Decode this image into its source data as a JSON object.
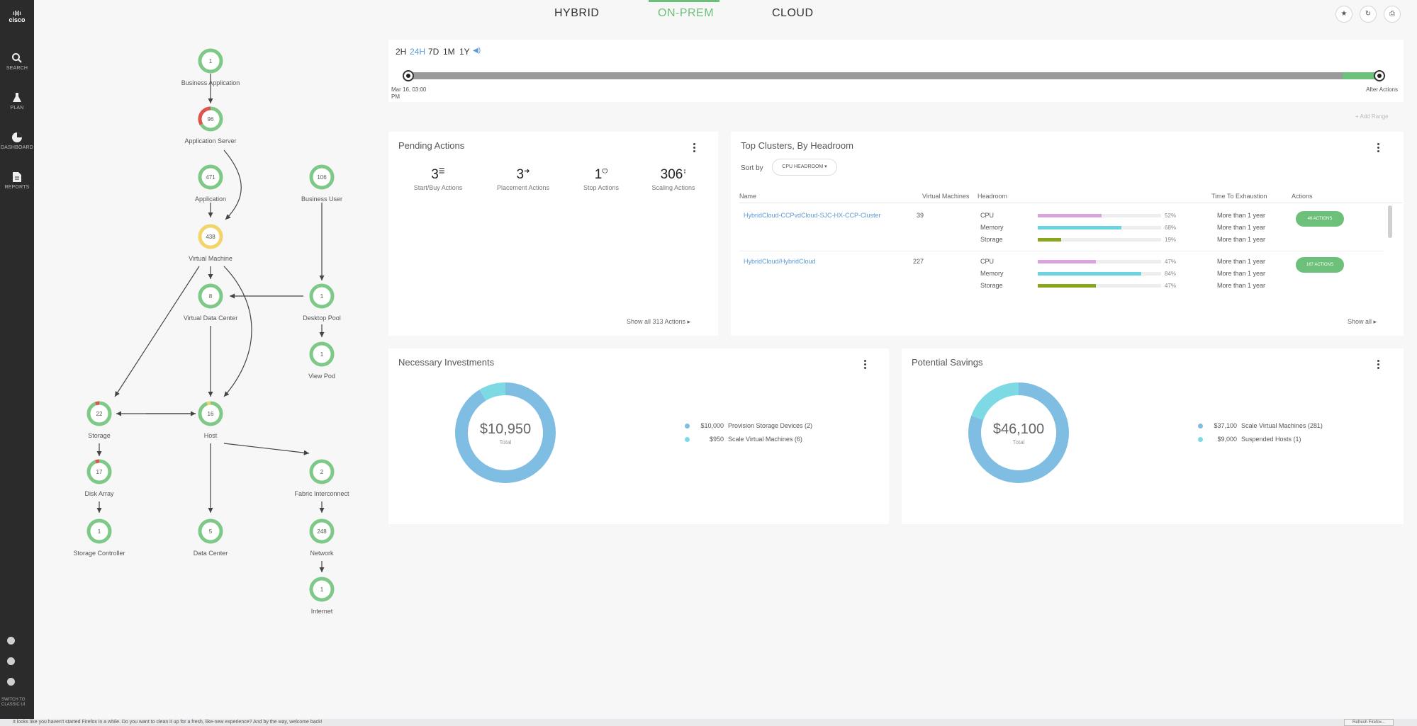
{
  "brand": {
    "logo_text": "cisco"
  },
  "sidebar": {
    "items": [
      {
        "label": "SEARCH",
        "icon": "search-icon"
      },
      {
        "label": "PLAN",
        "icon": "flask-icon"
      },
      {
        "label": "DASHBOARD",
        "icon": "dashboard-icon"
      },
      {
        "label": "REPORTS",
        "icon": "report-icon"
      }
    ],
    "footer": "SWITCH TO CLASSIC UI"
  },
  "tabs": [
    {
      "label": "HYBRID",
      "active": false
    },
    {
      "label": "ON-PREM",
      "active": true
    },
    {
      "label": "CLOUD",
      "active": false
    }
  ],
  "colors": {
    "accent_green": "#6cc07a",
    "link_blue": "#5b9bd5",
    "donut_blue": "#7fbde3",
    "donut_cyan": "#7dd9e3",
    "cpu_pink": "#d9a3e0",
    "mem_cyan": "#6cd3e0",
    "storage_olive": "#8aa61e"
  },
  "topology": {
    "nodes": [
      {
        "id": "business-application",
        "count": "1",
        "label": "Business Application"
      },
      {
        "id": "application-server",
        "count": "96",
        "label": "Application Server"
      },
      {
        "id": "application",
        "count": "471",
        "label": "Application"
      },
      {
        "id": "business-user",
        "count": "106",
        "label": "Business User"
      },
      {
        "id": "virtual-machine",
        "count": "438",
        "label": "Virtual Machine"
      },
      {
        "id": "virtual-data-center",
        "count": "8",
        "label": "Virtual Data Center"
      },
      {
        "id": "desktop-pool",
        "count": "1",
        "label": "Desktop Pool"
      },
      {
        "id": "view-pod",
        "count": "1",
        "label": "View Pod"
      },
      {
        "id": "storage",
        "count": "22",
        "label": "Storage"
      },
      {
        "id": "host",
        "count": "16",
        "label": "Host"
      },
      {
        "id": "disk-array",
        "count": "17",
        "label": "Disk Array"
      },
      {
        "id": "fabric-interconnect",
        "count": "2",
        "label": "Fabric Interconnect"
      },
      {
        "id": "storage-controller",
        "count": "1",
        "label": "Storage Controller"
      },
      {
        "id": "data-center",
        "count": "5",
        "label": "Data Center"
      },
      {
        "id": "network",
        "count": "248",
        "label": "Network"
      },
      {
        "id": "internet",
        "count": "1",
        "label": "Internet"
      }
    ]
  },
  "timeline": {
    "options": [
      "2H",
      "24H",
      "7D",
      "1M",
      "1Y"
    ],
    "selected": "24H",
    "start_label": "Mar 16, 03:00 PM",
    "end_label": "After Actions",
    "add_range": "+ Add Range"
  },
  "pending_actions": {
    "title": "Pending Actions",
    "items": [
      {
        "count": "3",
        "label": "Start/Buy Actions",
        "icon": "list-icon"
      },
      {
        "count": "3",
        "label": "Placement Actions",
        "icon": "arrow-right-icon"
      },
      {
        "count": "1",
        "label": "Stop Actions",
        "icon": "power-icon"
      },
      {
        "count": "306",
        "label": "Scaling Actions",
        "icon": "resize-icon"
      }
    ],
    "show_all": "Show all 313 Actions ▸"
  },
  "top_clusters": {
    "title": "Top Clusters, By Headroom",
    "sort_label": "Sort by",
    "sort_value": "CPU HEADROOM ▾",
    "columns": [
      "Name",
      "Virtual Machines",
      "Headroom",
      "Time To Exhaustion",
      "Actions"
    ],
    "rows": [
      {
        "name": "HybridCloud-CCPvdCloud-SJC-HX-CCP-Cluster",
        "vms": "39",
        "resources": [
          {
            "label": "CPU",
            "pct_text": "52%",
            "pct": 52,
            "tte": "More than 1 year"
          },
          {
            "label": "Memory",
            "pct_text": "68%",
            "pct": 68,
            "tte": "More than 1 year"
          },
          {
            "label": "Storage",
            "pct_text": "19%",
            "pct": 19,
            "tte": "More than 1 year"
          }
        ],
        "action": "46 ACTIONS"
      },
      {
        "name": "HybridCloud/HybridCloud",
        "vms": "227",
        "resources": [
          {
            "label": "CPU",
            "pct_text": "47%",
            "pct": 47,
            "tte": "More than 1 year"
          },
          {
            "label": "Memory",
            "pct_text": "84%",
            "pct": 84,
            "tte": "More than 1 year"
          },
          {
            "label": "Storage",
            "pct_text": "47%",
            "pct": 47,
            "tte": "More than 1 year"
          }
        ],
        "action": "167 ACTIONS"
      }
    ],
    "show_all": "Show all ▸"
  },
  "necessary_investments": {
    "title": "Necessary Investments",
    "total": "$10,950",
    "total_label": "Total",
    "segments": [
      {
        "amount": "$10,000",
        "label": "Provision Storage Devices (2)",
        "value": 10000,
        "color": "#7fbde3"
      },
      {
        "amount": "$950",
        "label": "Scale Virtual Machines (6)",
        "value": 950,
        "color": "#7dd9e3"
      }
    ]
  },
  "potential_savings": {
    "title": "Potential Savings",
    "total": "$46,100",
    "total_label": "Total",
    "segments": [
      {
        "amount": "$37,100",
        "label": "Scale Virtual Machines (281)",
        "value": 37100,
        "color": "#7fbde3"
      },
      {
        "amount": "$9,000",
        "label": "Suspended Hosts (1)",
        "value": 9000,
        "color": "#7dd9e3"
      }
    ]
  },
  "notification": {
    "message": "It looks like you haven't started Firefox in a while. Do you want to clean it up for a fresh, like-new experience? And by the way, welcome back!",
    "button": "Refresh Firefox..."
  }
}
